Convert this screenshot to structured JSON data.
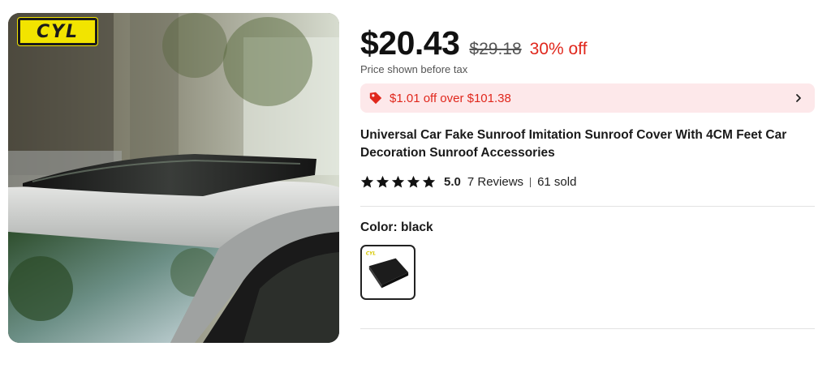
{
  "product_image": {
    "brand_logo_text": "CYL",
    "alt": "Car roof with black imitation sunroof cover"
  },
  "price": {
    "current": "$20.43",
    "original": "$29.18",
    "discount": "30% off",
    "tax_note": "Price shown before tax"
  },
  "coupon": {
    "text": "$1.01 off over $101.38",
    "icon": "tag-icon",
    "action_icon": "chevron-right-icon"
  },
  "title": "Universal Car Fake Sunroof Imitation Sunroof Cover With 4CM Feet Car Decoration Sunroof Accessories",
  "rating": {
    "stars": 5,
    "value": "5.0",
    "reviews": "7 Reviews",
    "sold": "61 sold"
  },
  "color": {
    "label": "Color:",
    "selected": "black",
    "swatch_logo_text": "CYL"
  },
  "colors": {
    "accent_red": "#e0271c",
    "coupon_bg": "#fde8ea",
    "logo_yellow": "#f2e400"
  }
}
